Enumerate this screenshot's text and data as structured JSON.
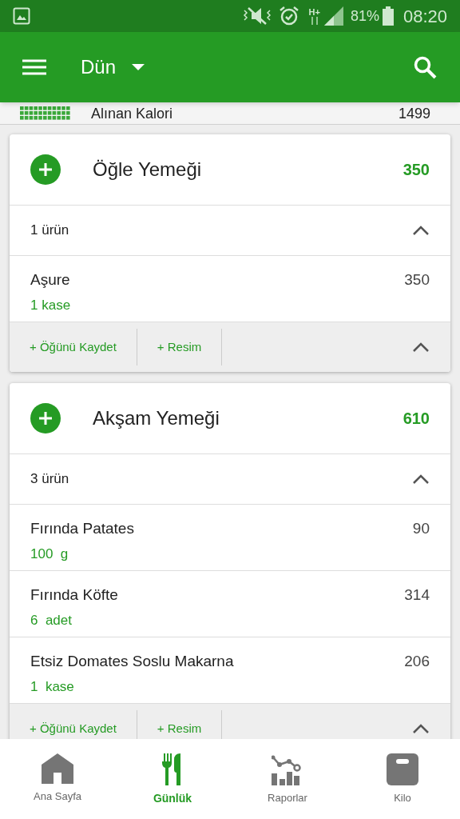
{
  "status_bar": {
    "network": "H+",
    "battery": "81%",
    "time": "08:20"
  },
  "app_bar": {
    "title": "Dün"
  },
  "summary": {
    "label": "Alınan Kalori",
    "value": "1499"
  },
  "meals": [
    {
      "title": "Öğle Yemeği",
      "calories": "350",
      "count": "1 ürün",
      "expanded": true,
      "items": [
        {
          "name": "Aşure",
          "amount": "1 kase",
          "calories": "350"
        }
      ],
      "actions": [
        "+ Öğünü Kaydet",
        "+ Resim"
      ]
    },
    {
      "title": "Akşam Yemeği",
      "calories": "610",
      "count": "3 ürün",
      "expanded": true,
      "items": [
        {
          "name": "Fırında Patates",
          "amount": "100  g",
          "calories": "90"
        },
        {
          "name": "Fırında Köfte",
          "amount": "6  adet",
          "calories": "314"
        },
        {
          "name": "Etsiz Domates Soslu Makarna",
          "amount": "1  kase",
          "calories": "206"
        }
      ],
      "actions": [
        "+ Öğünü Kaydet",
        "+ Resim"
      ]
    }
  ],
  "bottom_nav": [
    {
      "label": "Ana Sayfa",
      "kind": "home",
      "selected": false
    },
    {
      "label": "Günlük",
      "kind": "diary",
      "selected": true
    },
    {
      "label": "Raporlar",
      "kind": "reports",
      "selected": false
    },
    {
      "label": "Kilo",
      "kind": "scale",
      "selected": false
    }
  ]
}
